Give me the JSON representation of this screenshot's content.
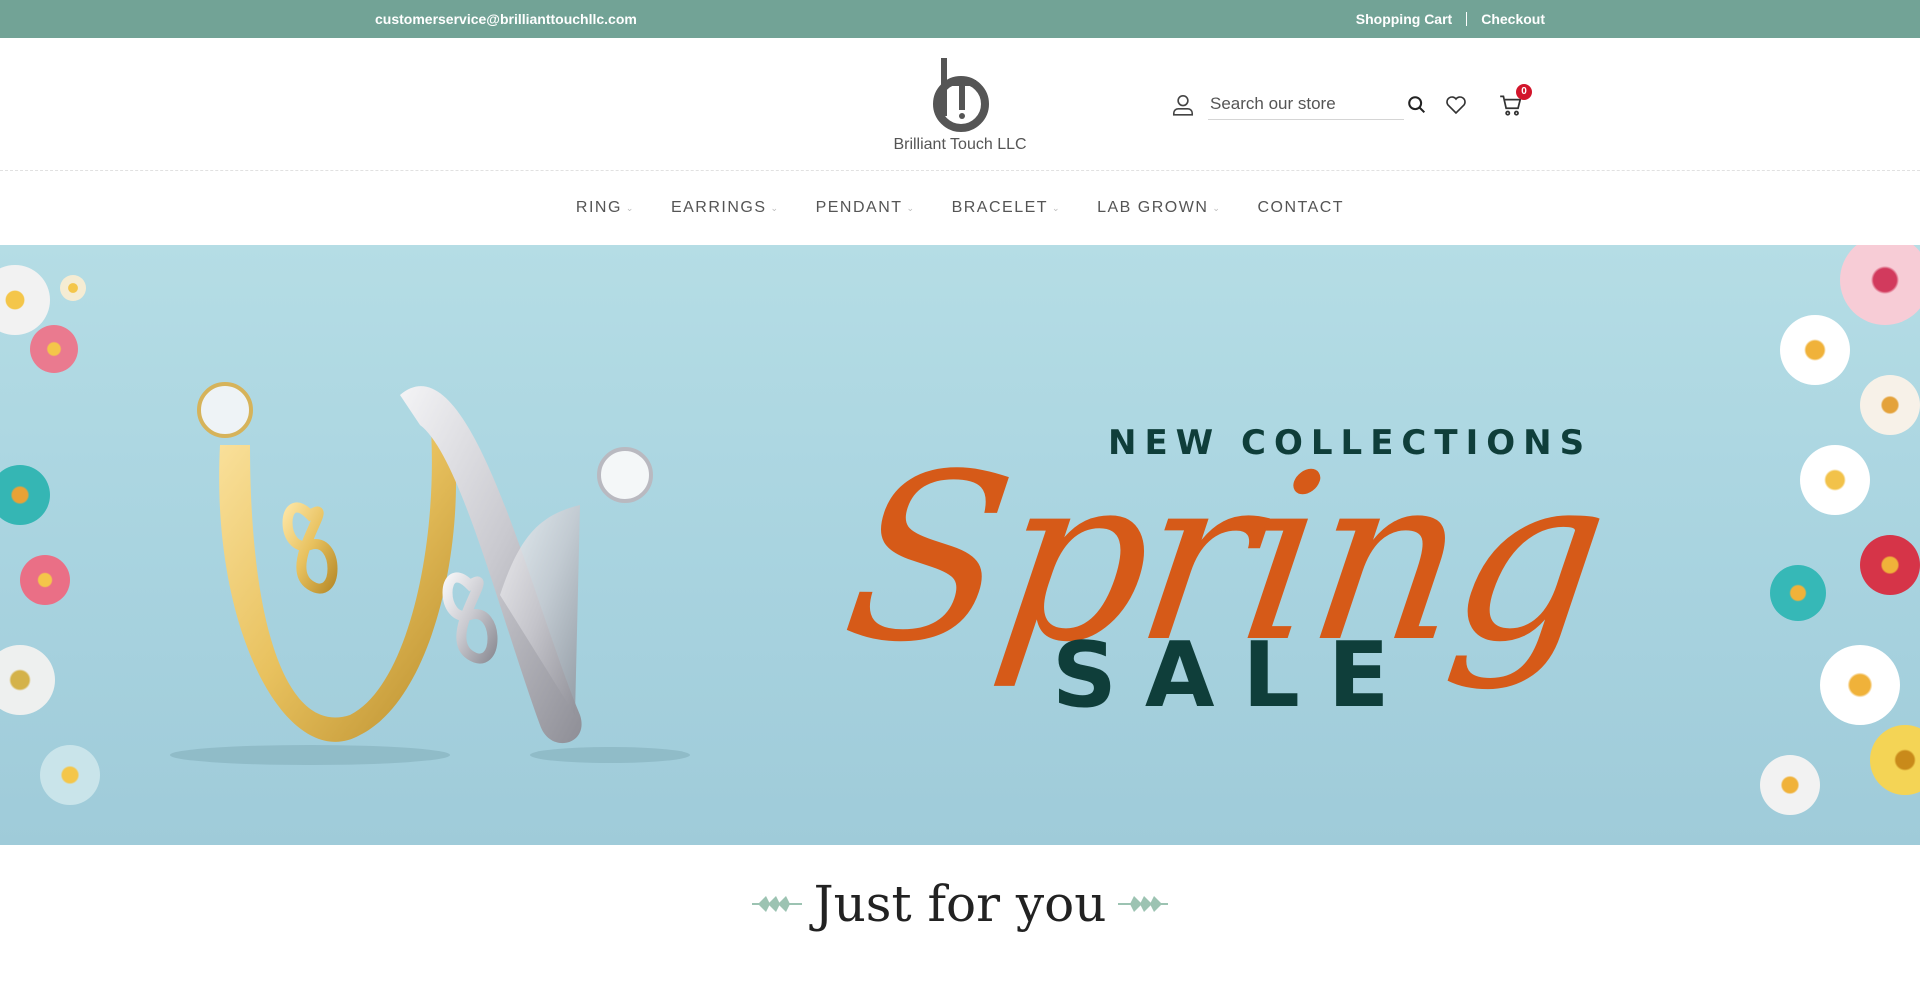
{
  "topbar": {
    "email": "customerservice@brillianttouchllc.com",
    "shopping_cart": "Shopping Cart",
    "checkout": "Checkout"
  },
  "header": {
    "brand": "Brilliant Touch LLC",
    "search_placeholder": "Search our store",
    "cart_count": "0"
  },
  "nav": {
    "items": [
      {
        "label": "RING",
        "has_dropdown": true
      },
      {
        "label": "EARRINGS",
        "has_dropdown": true
      },
      {
        "label": "PENDANT",
        "has_dropdown": true
      },
      {
        "label": "BRACELET",
        "has_dropdown": true
      },
      {
        "label": "LAB GROWN",
        "has_dropdown": true
      },
      {
        "label": "CONTACT",
        "has_dropdown": false
      }
    ]
  },
  "hero": {
    "line1": "NEW COLLECTIONS",
    "line2": "Spring",
    "line3": "SALE"
  },
  "section": {
    "title": "Just for you"
  },
  "colors": {
    "topbar": "#72a396",
    "accent_orange": "#d65a18",
    "dark_green": "#0f3e3a",
    "badge": "#d2152b"
  }
}
